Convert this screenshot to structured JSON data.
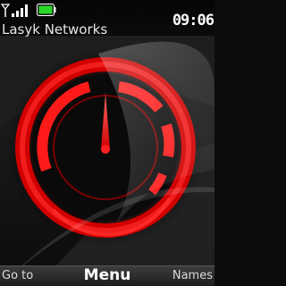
{
  "status_bar": {
    "signal_icon": "signal-strength-icon",
    "battery_icon": "battery-icon",
    "battery_color": "#2bd62b",
    "time": "09:06"
  },
  "operator_name": "Lasyk Networks",
  "softkeys": {
    "left": "Go to",
    "center": "Menu",
    "right": "Names"
  },
  "theme": {
    "accent": "#ff1a1a",
    "background": "#111111"
  },
  "wallpaper_icon": "speedometer-gauge"
}
